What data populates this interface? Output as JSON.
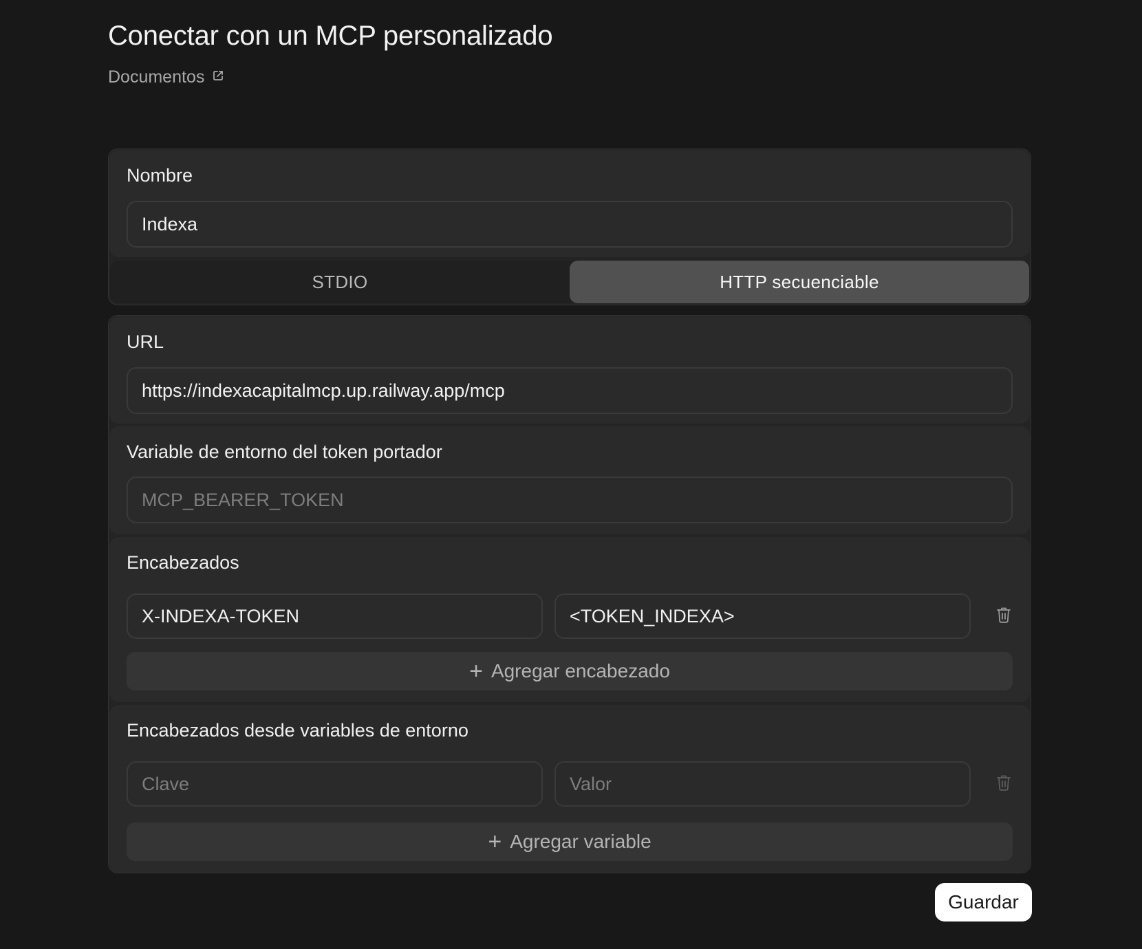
{
  "header": {
    "title": "Conectar con un MCP personalizado",
    "docs_label": "Documentos",
    "docs_icon": "external-link-icon"
  },
  "name_section": {
    "label": "Nombre",
    "value": "Indexa"
  },
  "transport_toggle": {
    "options": [
      "STDIO",
      "HTTP secuenciable"
    ],
    "selected": "HTTP secuenciable"
  },
  "url_section": {
    "label": "URL",
    "value": "https://indexacapitalmcp.up.railway.app/mcp"
  },
  "bearer_section": {
    "label": "Variable de entorno del token portador",
    "placeholder": "MCP_BEARER_TOKEN",
    "value": ""
  },
  "headers_section": {
    "label": "Encabezados",
    "rows": [
      {
        "key": "X-INDEXA-TOKEN",
        "value": "<TOKEN_INDEXA>"
      }
    ],
    "add_label": "Agregar encabezado"
  },
  "env_headers_section": {
    "label": "Encabezados desde variables de entorno",
    "key_placeholder": "Clave",
    "value_placeholder": "Valor",
    "add_label": "Agregar variable"
  },
  "footer": {
    "save_label": "Guardar"
  },
  "colors": {
    "background": "#181818",
    "card": "#242424",
    "section": "#2a2a2a",
    "toggle_active": "#515151",
    "save_button": "#ffffff"
  }
}
